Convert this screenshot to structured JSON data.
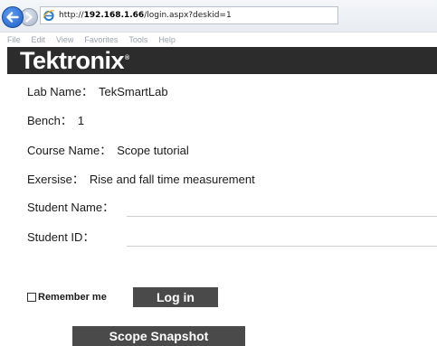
{
  "browser": {
    "url_prefix": "http://",
    "url_host": "192.168.1.66",
    "url_path": "/login.aspx?deskid=1",
    "menu": [
      "File",
      "Edit",
      "View",
      "Favorites",
      "Tools",
      "Help"
    ]
  },
  "brand": {
    "logo_text": "Tektronix",
    "registered": "®",
    "header_color": "#2c2c2c"
  },
  "info": {
    "lab_label": "Lab Name",
    "lab_value": "TekSmartLab",
    "bench_label": "Bench",
    "bench_value": "1",
    "course_label": "Course Name",
    "course_value": "Scope tutorial",
    "exercise_label": "Exersise",
    "exercise_value": "Rise and fall time measurement",
    "colon": "："
  },
  "form": {
    "student_name_label": "Student Name",
    "student_name_value": "",
    "student_id_label": "Student ID",
    "student_id_value": "",
    "colon": "：",
    "remember_label": "Remember me",
    "remember_checked": false,
    "login_label": "Log in",
    "snapshot_label": "Scope Snapshot"
  },
  "colors": {
    "button_bg": "#4a4a4a",
    "nav_back": "#1f5fc8"
  }
}
